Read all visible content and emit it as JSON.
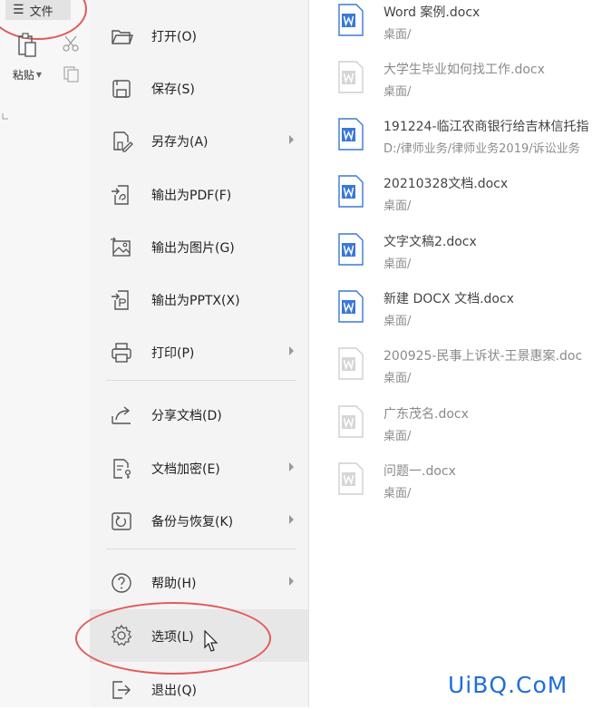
{
  "ribbon": {
    "file_tab_label": "文件",
    "paste_label": "粘贴"
  },
  "menu": {
    "items": [
      {
        "label": "打开(O)",
        "icon": "folder-open-icon",
        "submenu": false
      },
      {
        "label": "保存(S)",
        "icon": "save-icon",
        "submenu": false
      },
      {
        "label": "另存为(A)",
        "icon": "save-as-icon",
        "submenu": true
      },
      {
        "label": "输出为PDF(F)",
        "icon": "export-pdf-icon",
        "submenu": false
      },
      {
        "label": "输出为图片(G)",
        "icon": "export-image-icon",
        "submenu": false
      },
      {
        "label": "输出为PPTX(X)",
        "icon": "export-pptx-icon",
        "submenu": false
      },
      {
        "label": "打印(P)",
        "icon": "print-icon",
        "submenu": true
      },
      {
        "label": "分享文档(D)",
        "icon": "share-icon",
        "submenu": false
      },
      {
        "label": "文档加密(E)",
        "icon": "encrypt-icon",
        "submenu": true
      },
      {
        "label": "备份与恢复(K)",
        "icon": "backup-icon",
        "submenu": true
      },
      {
        "label": "帮助(H)",
        "icon": "help-icon",
        "submenu": true
      },
      {
        "label": "选项(L)",
        "icon": "gear-icon",
        "submenu": false
      },
      {
        "label": "退出(Q)",
        "icon": "exit-icon",
        "submenu": false
      }
    ]
  },
  "recent_files": [
    {
      "name": "Word 案例.docx",
      "path": "桌面/",
      "faded": false
    },
    {
      "name": "大学生毕业如何找工作.docx",
      "path": "桌面/",
      "faded": true
    },
    {
      "name": "191224-临江农商银行给吉林信托指",
      "path": "D:/律师业务/律师业务2019/诉讼业务",
      "faded": false
    },
    {
      "name": "20210328文档.docx",
      "path": "桌面/",
      "faded": false
    },
    {
      "name": "文字文稿2.docx",
      "path": "桌面/",
      "faded": false
    },
    {
      "name": "新建 DOCX 文档.docx",
      "path": "桌面/",
      "faded": false
    },
    {
      "name": "200925-民事上诉状-王景惠案.doc",
      "path": "桌面/",
      "faded": true
    },
    {
      "name": "广东茂名.docx",
      "path": "桌面/",
      "faded": true
    },
    {
      "name": "问题一.docx",
      "path": "桌面/",
      "faded": true
    }
  ],
  "watermark": "UiBQ.CoM",
  "colors": {
    "doc_blue": "#3a78d8",
    "doc_faded": "#cfcfcf",
    "annotation_red": "#e25a5a",
    "watermark_blue": "#1e6fd6"
  }
}
